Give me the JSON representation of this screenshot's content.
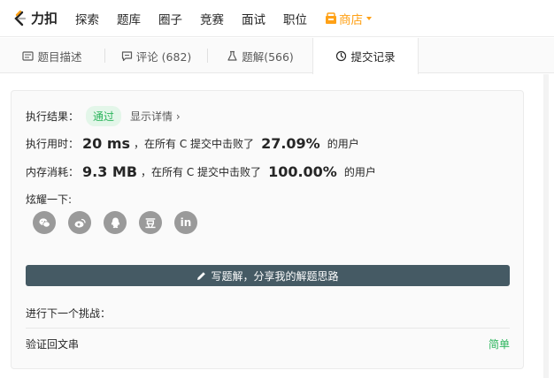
{
  "nav": {
    "logo_text": "力扣",
    "items": [
      "探索",
      "题库",
      "圈子",
      "竞赛",
      "面试",
      "职位"
    ],
    "store_label": "商店"
  },
  "tabs": [
    {
      "label": "题目描述",
      "icon": "description-icon"
    },
    {
      "label": "评论 (682)",
      "icon": "comment-icon"
    },
    {
      "label": "题解(566)",
      "icon": "flask-icon"
    },
    {
      "label": "提交记录",
      "icon": "clock-icon"
    }
  ],
  "active_tab": 3,
  "result": {
    "label": "执行结果：",
    "status": "通过",
    "details_link": "显示详情 ›"
  },
  "runtime": {
    "label": "执行用时：",
    "value": "20 ms",
    "middle": "，在所有 C 提交中击败了",
    "percent": "27.09%",
    "suffix": "的用户"
  },
  "memory": {
    "label": "内存消耗：",
    "value": "9.3 MB",
    "middle": "，在所有 C 提交中击败了",
    "percent": "100.00%",
    "suffix": "的用户"
  },
  "share": {
    "label": "炫耀一下:",
    "icons": [
      "wechat-icon",
      "weibo-icon",
      "qq-icon",
      "douban-icon",
      "linkedin-icon"
    ],
    "douban_glyph": "豆",
    "linkedin_glyph": "in"
  },
  "write_solution_label": "写题解，分享我的解题思路",
  "next_challenge": {
    "label": "进行下一个挑战：",
    "problem": "验证回文串",
    "difficulty": "简单"
  },
  "colors": {
    "accent": "#ffa116",
    "success": "#2db55d",
    "button": "#455a64"
  }
}
